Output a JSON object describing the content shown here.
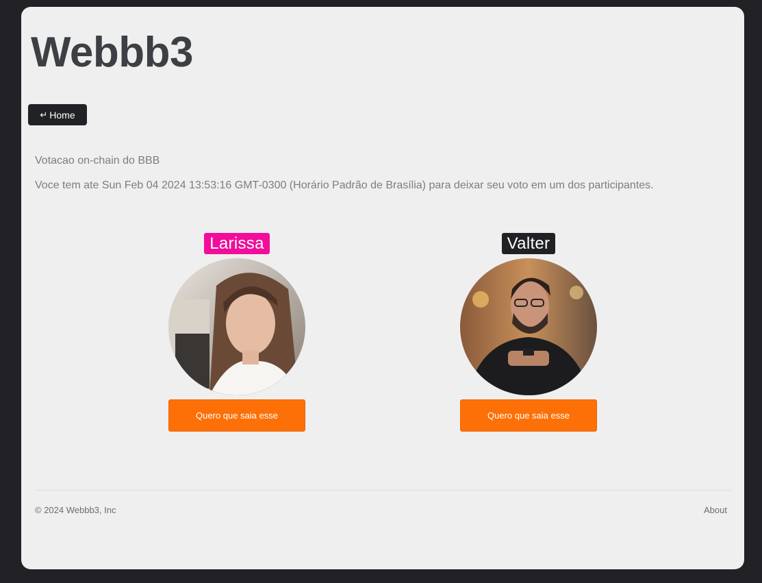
{
  "header": {
    "title": "Webbb3"
  },
  "nav": {
    "home_label": "Home",
    "home_icon": "return-arrow-icon"
  },
  "intro": {
    "subtitle": "Votacao on-chain do BBB",
    "deadline": "Voce tem ate Sun Feb 04 2024 13:53:16 GMT-0300 (Horário Padrão de Brasília) para deixar seu voto em um dos participantes."
  },
  "participants": [
    {
      "name": "Larissa",
      "badge_color": "#f20d9a",
      "vote_label": "Quero que saia esse"
    },
    {
      "name": "Valter",
      "badge_color": "#1f2125",
      "vote_label": "Quero que saia esse"
    }
  ],
  "colors": {
    "accent": "#fd7007",
    "background": "#efefef",
    "frame": "#222226"
  },
  "footer": {
    "copyright": "© 2024 Webbb3, Inc",
    "about_label": "About"
  }
}
